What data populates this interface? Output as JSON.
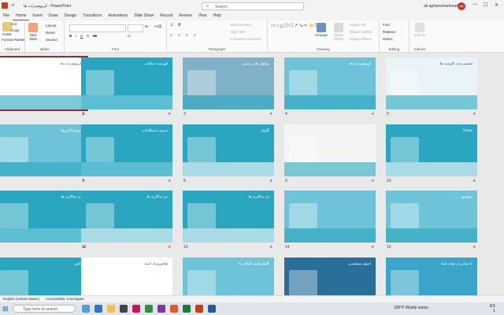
{
  "app": {
    "window_title": "کربوهیدرات ها  -  PowerPoint",
    "search_placeholder": "Search",
    "user_name": "ali aghamohammadi",
    "user_initials": "AA",
    "min": "—",
    "max": "☐",
    "close": "✕"
  },
  "menu": [
    "File",
    "Home",
    "Insert",
    "Draw",
    "Design",
    "Transitions",
    "Animations",
    "Slide Show",
    "Record",
    "Review",
    "View",
    "Help"
  ],
  "ribbon": {
    "clipboard": {
      "label": "Clipboard",
      "paste": "Paste",
      "cut": "Cut",
      "copy": "Copy",
      "format_painter": "Format Painter"
    },
    "slides": {
      "label": "Slides",
      "new_slide": "New Slide",
      "layout": "Layout",
      "reset": "Reset",
      "section": "Section"
    },
    "font": {
      "label": "Font"
    },
    "paragraph": {
      "label": "Paragraph",
      "text_direction": "Text Direction",
      "align_text": "Align Text",
      "convert_smartart": "Convert to SmartArt"
    },
    "drawing": {
      "label": "Drawing",
      "arrange": "Arrange",
      "quick_styles": "Quick Styles",
      "shape_fill": "Shape Fill",
      "shape_outline": "Shape Outline",
      "shape_effects": "Shape Effects"
    },
    "editing": {
      "label": "Editing",
      "find": "Find",
      "replace": "Replace",
      "select": "Select"
    },
    "addins": {
      "label": "Add-ins",
      "addins": "Add-ins"
    }
  },
  "slides": [
    {
      "num": "1",
      "title": "کربوهیدرات ها",
      "bg": "#ffffff",
      "accent": "#2aa6c0",
      "selected": true
    },
    {
      "num": "2",
      "title": "فهرست مطالب",
      "bg": "#2aa6c0",
      "accent": "#7fcfe0",
      "selected": false
    },
    {
      "num": "3",
      "title": "موکول های زیستی",
      "bg": "#7fb2c8",
      "accent": "#2aa6c0",
      "selected": false
    },
    {
      "num": "4",
      "title": "کربوهیدرات ها",
      "bg": "#6fc3d8",
      "accent": "#2aa6c0",
      "selected": false
    },
    {
      "num": "5",
      "title": "تقسیم بندی کلوسید ها",
      "bg": "#eaf4f8",
      "accent": "#2aa6c0",
      "selected": false
    },
    {
      "num": "6",
      "title": "مونوساکاریدها",
      "bg": "#6fc3d8",
      "accent": "#2aa6c0",
      "selected": false
    },
    {
      "num": "7",
      "title": "تعریف اصطلاحات",
      "bg": "#2aa6c0",
      "accent": "#7fcfe0",
      "selected": false
    },
    {
      "num": "8",
      "title": "گلوکز",
      "bg": "#2aa6c0",
      "accent": "#ffffff",
      "selected": false
    },
    {
      "num": "9",
      "title": "",
      "bg": "#f4f4f4",
      "accent": "#2aa6c0",
      "selected": false
    },
    {
      "num": "10",
      "title": "Triose",
      "bg": "#2aa6c0",
      "accent": "#ffffff",
      "selected": false
    },
    {
      "num": "11",
      "title": "دی ساکارید ها",
      "bg": "#2aa6c0",
      "accent": "#7fcfe0",
      "selected": false
    },
    {
      "num": "12",
      "title": "دی ساکارید ها",
      "bg": "#2aa6c0",
      "accent": "#ffffff",
      "selected": false
    },
    {
      "num": "13",
      "title": "دی ساکارید ها",
      "bg": "#2aa6c0",
      "accent": "#ffffff",
      "selected": false
    },
    {
      "num": "14",
      "title": "",
      "bg": "#6fc3d8",
      "accent": "#2aa6c0",
      "selected": false
    },
    {
      "num": "15",
      "title": "سلوبیوز",
      "bg": "#6fc3d8",
      "accent": "#2aa6c0",
      "selected": false
    },
    {
      "num": "16",
      "title": "پکتین",
      "bg": "#2aa6c0",
      "accent": "#ffffff",
      "selected": false
    },
    {
      "num": "17",
      "title": "هیالورونیک اسید",
      "bg": "#ffffff",
      "accent": "#2aa6c0",
      "selected": false
    },
    {
      "num": "18",
      "title": "گلیکوزآمینو گلیکان ها",
      "bg": "#6fc3d8",
      "accent": "#2aa6c0",
      "selected": false
    },
    {
      "num": "19",
      "title": "اصول بیوشیمی",
      "bg": "#2a6f9a",
      "accent": "#ffffff",
      "selected": false
    },
    {
      "num": "20",
      "title": "با سپاس از توجه شما",
      "bg": "#3aa5c8",
      "accent": "#ffffff",
      "selected": false
    }
  ],
  "statusbar": {
    "language": "English (United States)",
    "accessibility": "Accessibility: Investigate"
  },
  "taskbar": {
    "search_placeholder": "Type here to search",
    "weather": "100°F  Mostly sunny",
    "time": "8:5",
    "date": "1"
  }
}
